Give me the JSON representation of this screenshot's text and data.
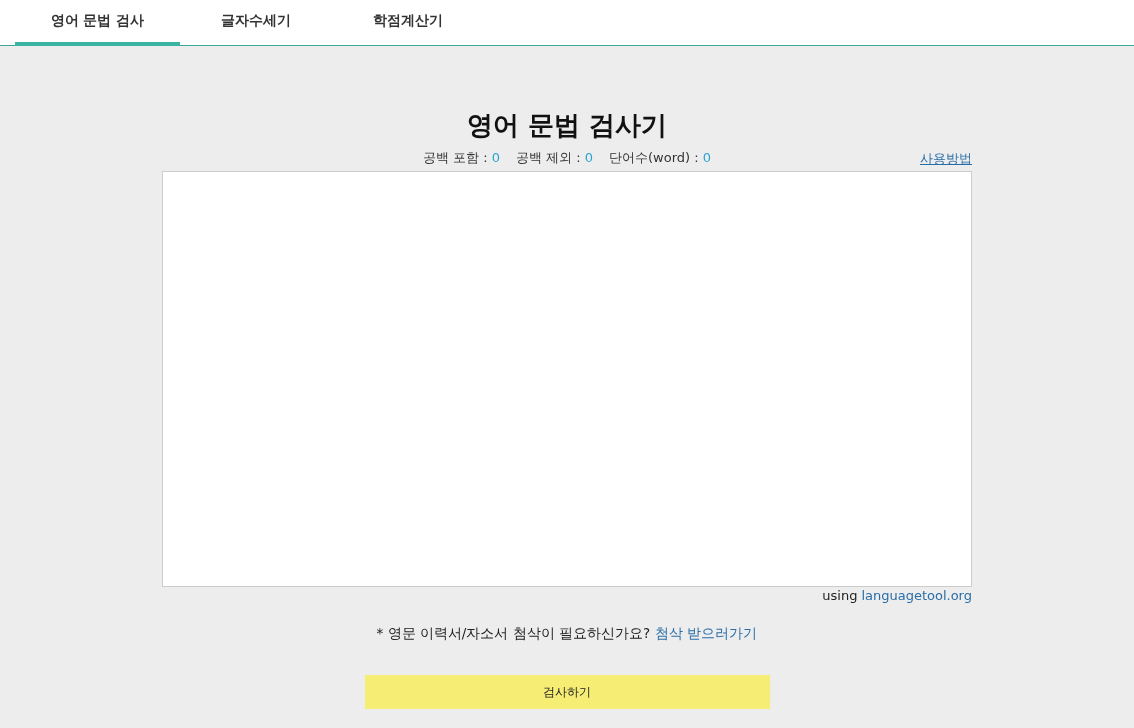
{
  "tabs": [
    {
      "label": "영어 문법 검사",
      "selected": true
    },
    {
      "label": "글자수세기",
      "selected": false
    },
    {
      "label": "학점계산기",
      "selected": false
    }
  ],
  "title": "영어 문법 검사기",
  "stats": [
    {
      "label": "공백 포함 :",
      "value": "0"
    },
    {
      "label": "공백 제외 :",
      "value": "0"
    },
    {
      "label": "단어수(word) :",
      "value": "0"
    }
  ],
  "help_link": "사용방법",
  "credit": {
    "prefix": "using",
    "link": "languagetool.org"
  },
  "notice": {
    "text": "* 영문 이력서/자소서 첨삭이 필요하신가요?",
    "link": "첨삭 받으러가기"
  },
  "submit_button": "검사하기"
}
